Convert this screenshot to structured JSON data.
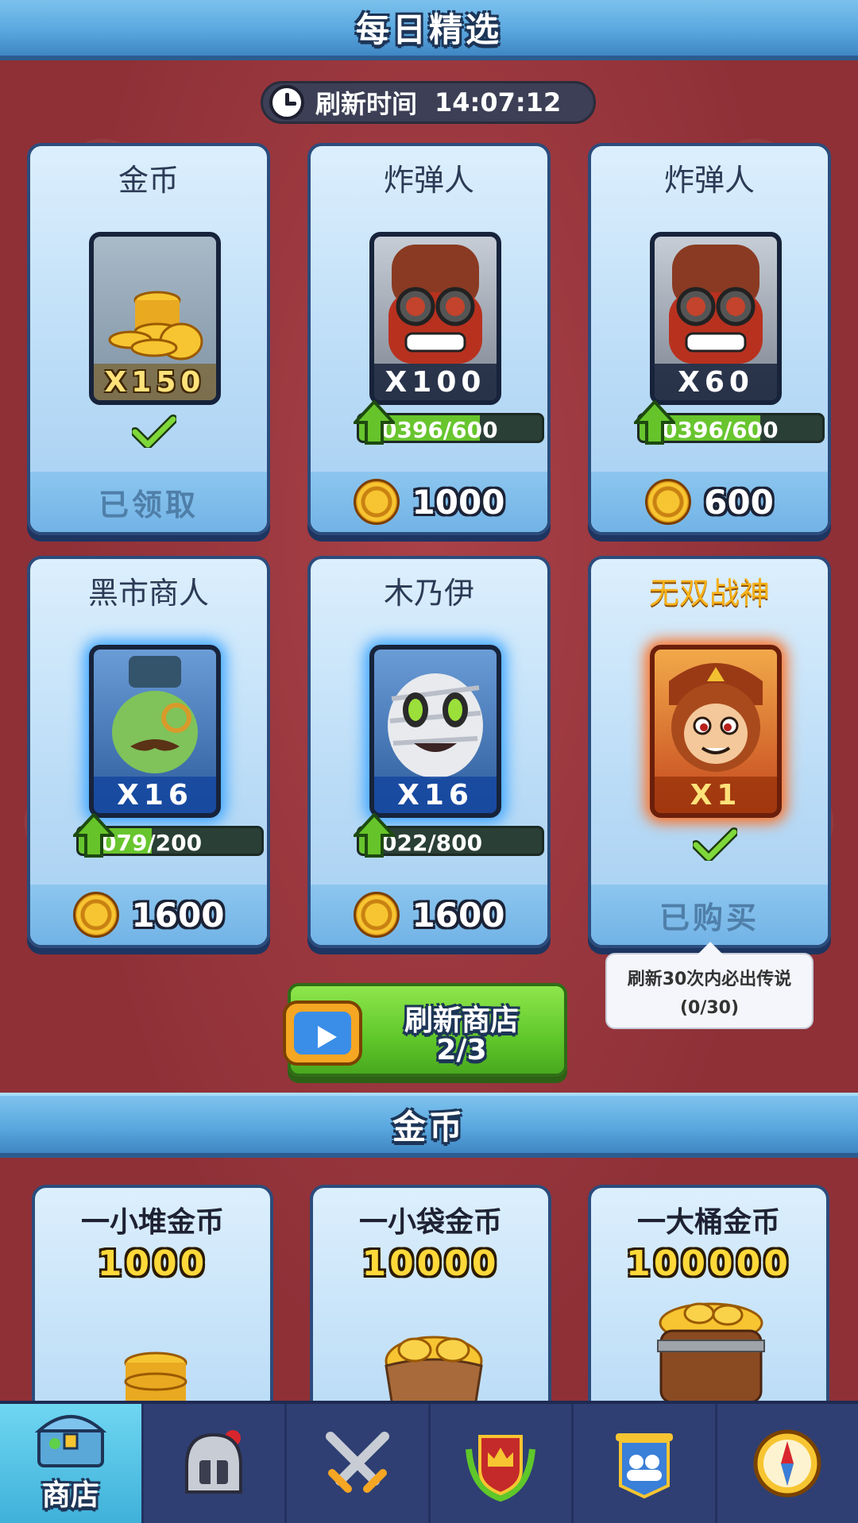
{
  "daily": {
    "title": "每日精选",
    "refresh_label": "刷新时间",
    "refresh_time": "14:07:12",
    "cards": [
      {
        "title": "金币",
        "qty": "X150",
        "status": "已领取"
      },
      {
        "title": "炸弹人",
        "qty": "X100",
        "progress": "0396/600",
        "progress_fraction": 0.66,
        "price": "1000"
      },
      {
        "title": "炸弹人",
        "qty": "X60",
        "progress": "0396/600",
        "progress_fraction": 0.66,
        "price": "600"
      },
      {
        "title": "黑市商人",
        "qty": "X16",
        "progress": "079/200",
        "progress_fraction": 0.4,
        "price": "1600"
      },
      {
        "title": "木乃伊",
        "qty": "X16",
        "progress": "022/800",
        "progress_fraction": 0.03,
        "price": "1600"
      },
      {
        "title": "无双战神",
        "qty": "X1",
        "status": "已购买"
      }
    ],
    "refresh_button": {
      "label": "刷新商店",
      "count": "2/3"
    },
    "tooltip": {
      "line1": "刷新30次内必出传说",
      "line2": "(0/30)"
    }
  },
  "gold": {
    "title": "金币",
    "packs": [
      {
        "title": "一小堆金币",
        "amount": "1000"
      },
      {
        "title": "一小袋金币",
        "amount": "10000"
      },
      {
        "title": "一大桶金币",
        "amount": "100000"
      }
    ]
  },
  "nav": {
    "items": [
      {
        "label": "商店",
        "icon": "treasure-chest-icon"
      },
      {
        "label": "",
        "icon": "knight-helmet-icon"
      },
      {
        "label": "",
        "icon": "crossed-swords-icon"
      },
      {
        "label": "",
        "icon": "crown-shield-icon"
      },
      {
        "label": "",
        "icon": "guild-banner-icon"
      },
      {
        "label": "",
        "icon": "compass-icon"
      }
    ]
  },
  "colors": {
    "accent_blue": "#5aa8df",
    "bg_red": "#8f3037",
    "green_button": "#5fc72a",
    "coin_gold": "#f7c531"
  }
}
